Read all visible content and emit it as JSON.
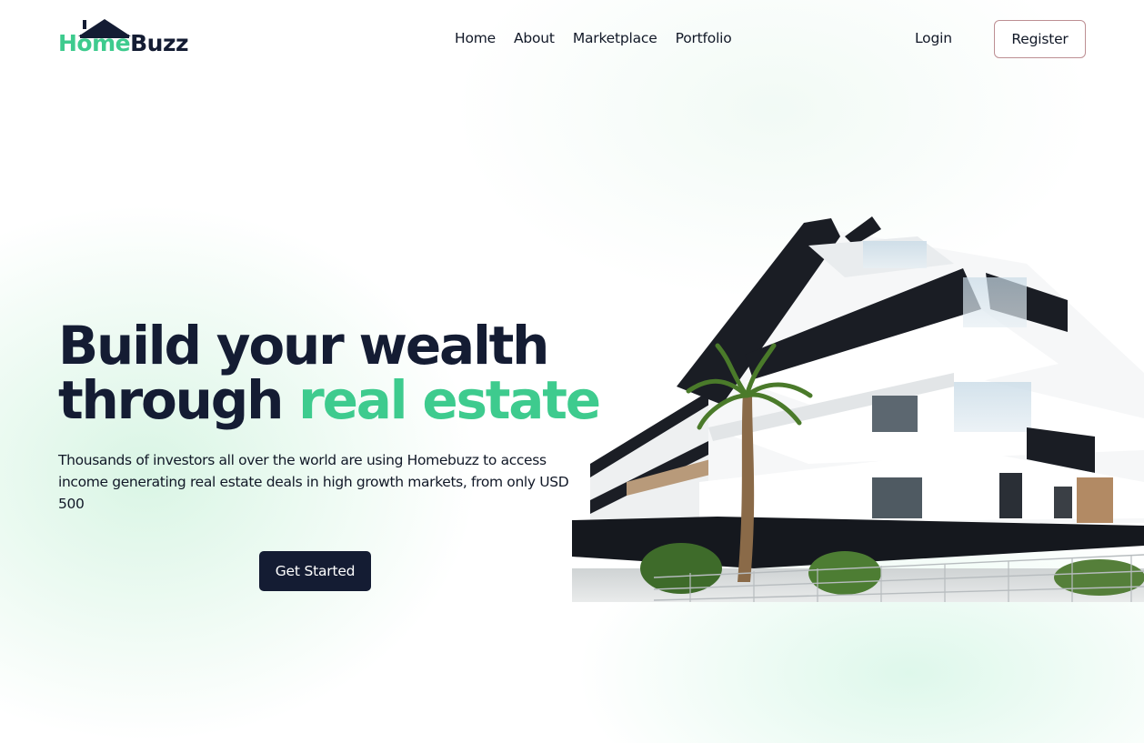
{
  "brand": {
    "name_part1": "Home",
    "name_part2": "Buzz",
    "accent_color": "#3ecb8e",
    "dark_color": "#141c33"
  },
  "nav": {
    "items": [
      "Home",
      "About",
      "Marketplace",
      "Portfolio"
    ]
  },
  "auth": {
    "login_label": "Login",
    "register_label": "Register"
  },
  "hero": {
    "headline_line1": "Build your wealth",
    "headline_line2_plain": "through",
    "headline_line2_accent": "real estate",
    "description": "Thousands of investors all over the world are using Homebuzz to access income generating real estate deals in high growth markets, from only USD 500",
    "cta_label": "Get Started",
    "image_subject": "modern-white-apartment-building"
  }
}
